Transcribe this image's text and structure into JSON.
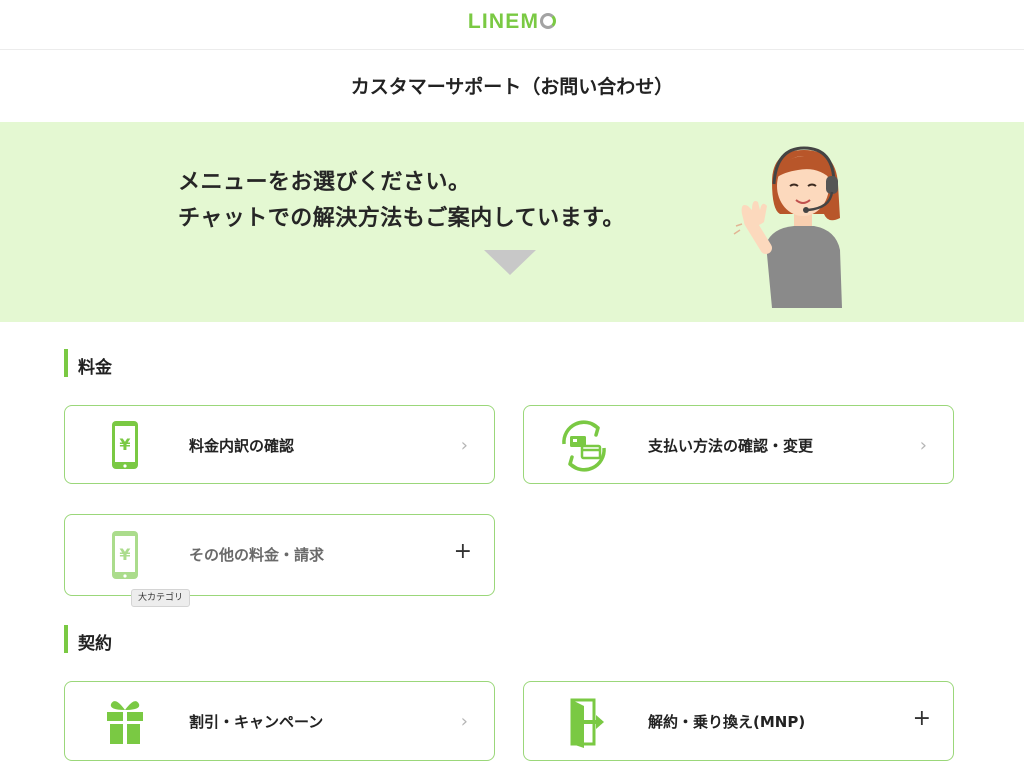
{
  "header": {
    "logo_text": "LINEM",
    "logo_label": "LINEMO"
  },
  "page": {
    "title": "カスタマーサポート（お問い合わせ）"
  },
  "banner": {
    "line1": "メニューをお選びください。",
    "line2": "チャットでの解決方法もご案内しています。"
  },
  "sections": [
    {
      "label": "料金",
      "cards": [
        {
          "label": "料金内訳の確認",
          "icon": "phone-yen-icon",
          "action": "chevron"
        },
        {
          "label": "支払い方法の確認・変更",
          "icon": "payment-exchange-icon",
          "action": "chevron"
        },
        {
          "label": "その他の料金・請求",
          "icon": "phone-yen-icon",
          "action": "plus"
        }
      ]
    },
    {
      "label": "契約",
      "cards": [
        {
          "label": "割引・キャンペーン",
          "icon": "gift-icon",
          "action": "chevron"
        },
        {
          "label": "解約・乗り換え(MNP)",
          "icon": "exit-door-icon",
          "action": "plus"
        }
      ]
    }
  ],
  "tooltip": {
    "text": "大カテゴリ"
  },
  "glyphs": {
    "chevron": "›",
    "plus": "+"
  },
  "colors": {
    "brand_green": "#7ac943",
    "banner_bg": "#e4f8d2",
    "card_border": "#9bd77a"
  }
}
